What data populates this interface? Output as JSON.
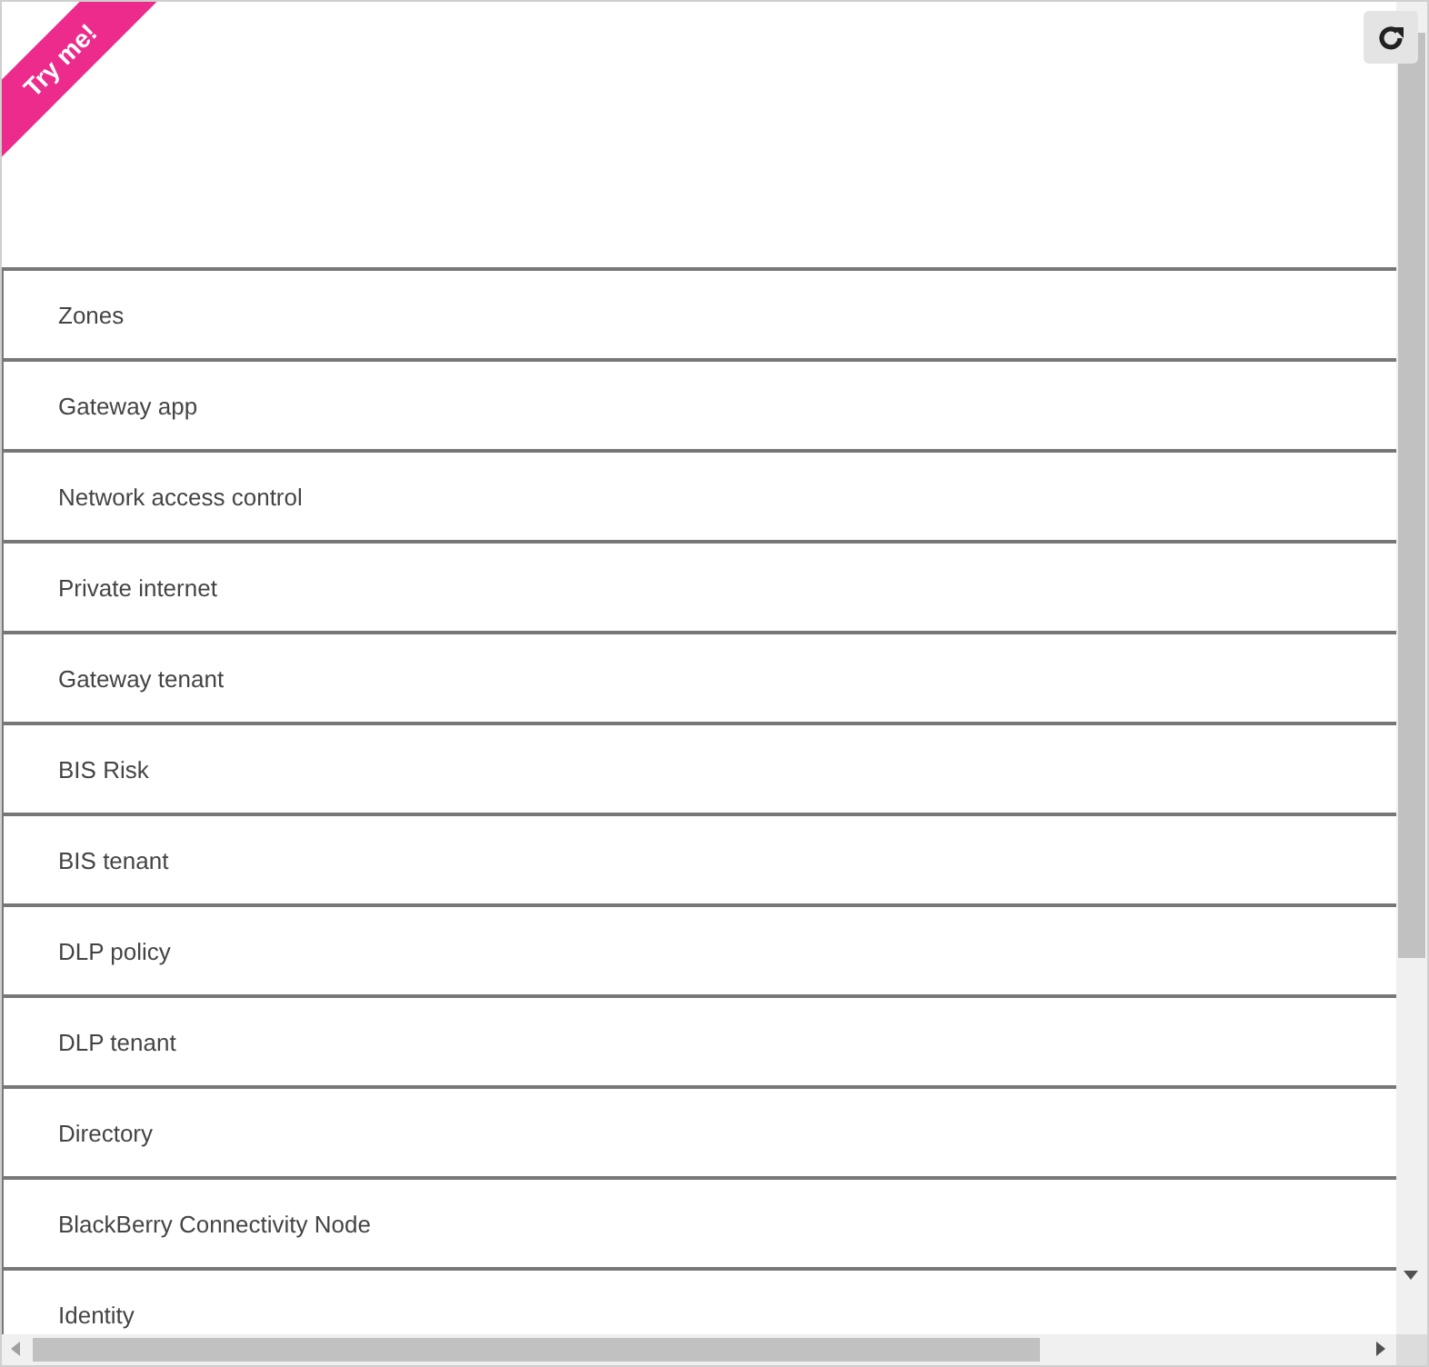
{
  "ribbon": {
    "text": "Try me!"
  },
  "items": [
    {
      "label": "Zones"
    },
    {
      "label": "Gateway app"
    },
    {
      "label": "Network access control"
    },
    {
      "label": "Private internet"
    },
    {
      "label": "Gateway tenant"
    },
    {
      "label": "BIS Risk"
    },
    {
      "label": "BIS tenant"
    },
    {
      "label": "DLP policy"
    },
    {
      "label": "DLP tenant"
    },
    {
      "label": "Directory"
    },
    {
      "label": "BlackBerry Connectivity Node"
    },
    {
      "label": "Identity"
    }
  ]
}
